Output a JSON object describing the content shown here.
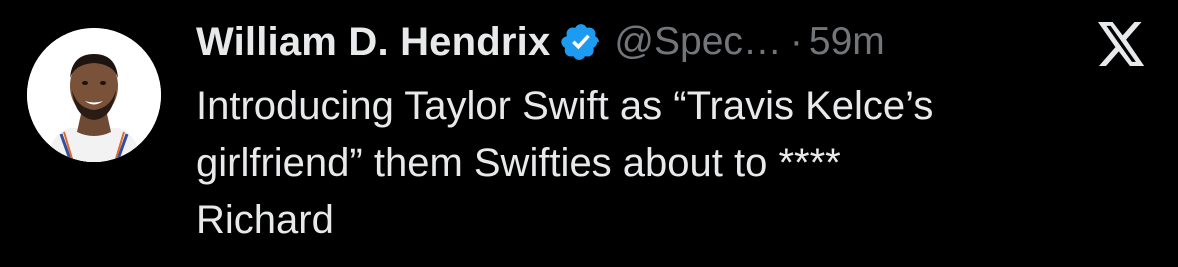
{
  "author": {
    "display_name": "William D. Hendrix",
    "handle": "@Spec…",
    "separator": "·",
    "time": "59m",
    "verified": true,
    "verified_color": "#1d9bf0"
  },
  "tweet": {
    "lines": [
      "Introducing Taylor Swift as “Travis Kelce’s",
      "girlfriend” them Swifties about to ****",
      "Richard"
    ]
  },
  "icons": {
    "avatar": "avatar-photo",
    "verified": "verified-badge-icon",
    "platform": "x-logo-icon"
  },
  "colors": {
    "background": "#000000",
    "primary_text": "#e7e9ea",
    "secondary_text": "#71767b"
  }
}
